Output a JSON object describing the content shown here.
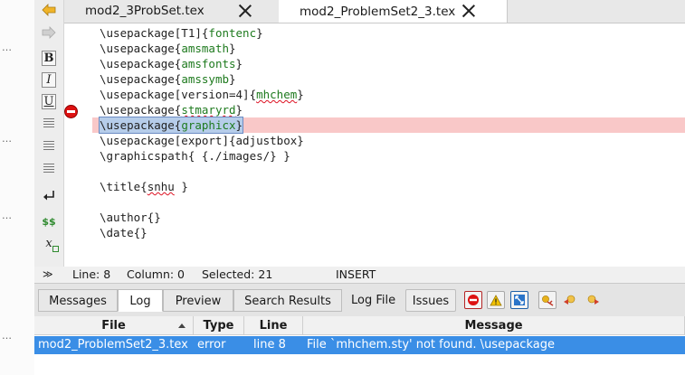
{
  "tabs": [
    {
      "label": "mod2_3ProbSet.tex",
      "active": false
    },
    {
      "label": "mod2_ProblemSet2_3.tex",
      "active": true
    }
  ],
  "editor": {
    "lines": [
      [
        {
          "t": "\\usepackage[T1]{"
        },
        {
          "t": "fontenc",
          "c": "arg"
        },
        {
          "t": "}"
        }
      ],
      [
        {
          "t": "\\usepackage{"
        },
        {
          "t": "amsmath",
          "c": "arg"
        },
        {
          "t": "}"
        }
      ],
      [
        {
          "t": "\\usepackage{"
        },
        {
          "t": "amsfonts",
          "c": "arg"
        },
        {
          "t": "}"
        }
      ],
      [
        {
          "t": "\\usepackage{"
        },
        {
          "t": "amssymb",
          "c": "arg"
        },
        {
          "t": "}"
        }
      ],
      [
        {
          "t": "\\usepackage[version=4]{"
        },
        {
          "t": "mhchem",
          "c": "arg squig"
        },
        {
          "t": "}"
        }
      ],
      [
        {
          "t": "\\usepackage{"
        },
        {
          "t": "stmaryrd",
          "c": "arg squig"
        },
        {
          "t": "}"
        }
      ],
      [
        {
          "t": "\\usepackage{"
        },
        {
          "t": "graphicx",
          "c": "arg"
        },
        {
          "t": "}"
        }
      ],
      [
        {
          "t": "\\usepackage[export]{adjustbox}"
        }
      ],
      [
        {
          "t": "\\graphicspath{ {./images/} }"
        }
      ],
      [],
      [
        {
          "t": "\\title{"
        },
        {
          "t": "snhu",
          "c": "squig"
        },
        {
          "t": " }"
        }
      ],
      [],
      [
        {
          "t": "\\author{}"
        }
      ],
      [
        {
          "t": "\\date{}"
        }
      ]
    ],
    "highlighted_line": 6,
    "error_line": 6
  },
  "status": {
    "line": "Line: 8",
    "column": "Column: 0",
    "selected": "Selected: 21",
    "mode": "INSERT"
  },
  "panel": {
    "tabs": [
      "Messages",
      "Log",
      "Preview",
      "Search Results"
    ],
    "active_tab": "Log",
    "log_file_label": "Log File",
    "issues_label": "Issues",
    "icons": [
      "stop-errors-icon",
      "warning-icon",
      "badbox-icon",
      "bookmark-toggle-icon",
      "previous-error-icon",
      "next-error-icon"
    ]
  },
  "log": {
    "columns": [
      "File",
      "Type",
      "Line",
      "Message"
    ],
    "rows": [
      {
        "file": "mod2_ProblemSet2_3.tex",
        "type": "error",
        "line": "line 8",
        "message": "File `mhchem.sty' not found. \\usepackage"
      }
    ]
  },
  "colors": {
    "selection_row": "#3a8ee6",
    "error_line_bg": "#f9c8c8",
    "latex_argument": "#1e7a1e",
    "error_marker": "#dd1111"
  }
}
